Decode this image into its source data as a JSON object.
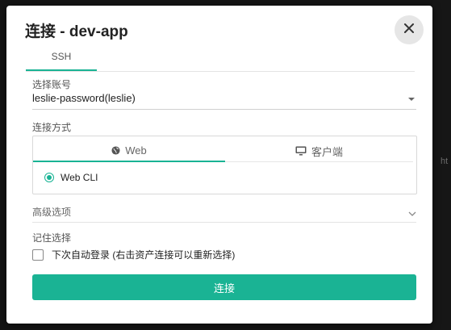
{
  "dialog": {
    "title": "连接 - dev-app",
    "close_icon": "close-icon"
  },
  "tabs": [
    {
      "label": "SSH",
      "active": true
    }
  ],
  "account": {
    "label": "选择账号",
    "value": "leslie-password(leslie)"
  },
  "connect_method": {
    "label": "连接方式",
    "tabs": [
      {
        "label": "Web",
        "icon": "globe-icon",
        "active": true
      },
      {
        "label": "客户端",
        "icon": "monitor-icon",
        "active": false
      }
    ],
    "option": {
      "label": "Web CLI",
      "selected": true
    }
  },
  "advanced": {
    "label": "高级选项"
  },
  "remember": {
    "label": "记住选择",
    "checkbox_label": "下次自动登录 (右击资产连接可以重新选择)",
    "checked": false
  },
  "submit_label": "连接",
  "background_hint": "ht",
  "colors": {
    "accent": "#1ab394",
    "backdrop": "#141414"
  }
}
